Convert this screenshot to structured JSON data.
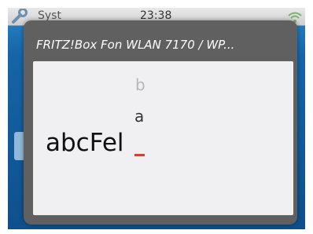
{
  "statusbar": {
    "label": "Syst",
    "time": "23:38",
    "tool_icon": "wrench-icon",
    "wifi_icon": "wifi-icon"
  },
  "dialog": {
    "title": "FRITZ!Box Fon WLAN 7170 / WP...",
    "picker": {
      "next_char": "b",
      "current_char": "a"
    },
    "input_value": "abcFel",
    "cursor_color": "#e03a2a"
  },
  "colors": {
    "dialog_bg": "#606060",
    "content_bg": "#f0f0f2",
    "screen_bg": "#1565a8"
  }
}
